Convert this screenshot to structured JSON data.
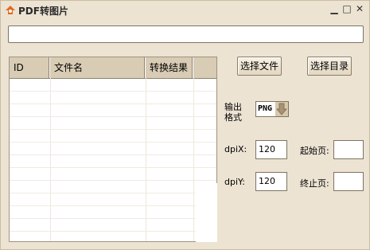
{
  "window": {
    "title": "PDF转图片",
    "minimize": "▁",
    "maximize": "□",
    "close": "✕"
  },
  "table": {
    "columns": [
      "ID",
      "文件名",
      "转换结果",
      ""
    ],
    "rows": []
  },
  "buttons": {
    "select_file": "选择文件",
    "select_dir": "选择目录"
  },
  "format": {
    "label": "输出格式",
    "value": "PNG"
  },
  "dpi_x": {
    "label": "dpiX:",
    "value": "120"
  },
  "dpi_y": {
    "label": "dpiY:",
    "value": "120"
  },
  "start_page": {
    "label": "起始页:",
    "value": ""
  },
  "end_page": {
    "label": "终止页:",
    "value": ""
  },
  "top_input": {
    "value": ""
  }
}
